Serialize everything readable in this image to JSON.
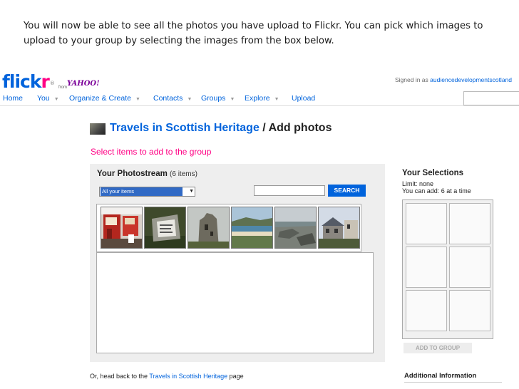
{
  "caption": "You will now be able to see all the photos you have upload to Flickr. You can pick which images to upload to your group by selecting the images from the box below.",
  "header": {
    "logo_main": "flick",
    "logo_r": "r",
    "logo_reg": "®",
    "from": "from",
    "yahoo": "YAHOO!",
    "signed_in_prefix": "Signed in as",
    "username": "audiencedevelopmentscotland"
  },
  "nav": {
    "home": "Home",
    "you": "You",
    "organize": "Organize & Create",
    "contacts": "Contacts",
    "groups": "Groups",
    "explore": "Explore",
    "upload": "Upload",
    "arrow": "▼"
  },
  "page": {
    "group_name": "Travels in Scottish Heritage",
    "title_suffix": " / Add photos",
    "subtitle": "Select items to add to the group"
  },
  "photostream": {
    "title": "Your Photostream",
    "count": "(6 items)",
    "filter_selected": "All your items",
    "search_label": "SEARCH"
  },
  "selections": {
    "title": "Your Selections",
    "limit": "Limit: none",
    "can_add": "You can add: 6 at a time",
    "add_button": "ADD TO GROUP"
  },
  "footer": {
    "prefix": "Or, head back to the",
    "group_link": "Travels in Scottish Heritage",
    "suffix": "page",
    "additional": "Additional Information"
  },
  "colors": {
    "brand_blue": "#0063dc",
    "brand_pink": "#ff0084",
    "yahoo_purple": "#7b0099"
  }
}
